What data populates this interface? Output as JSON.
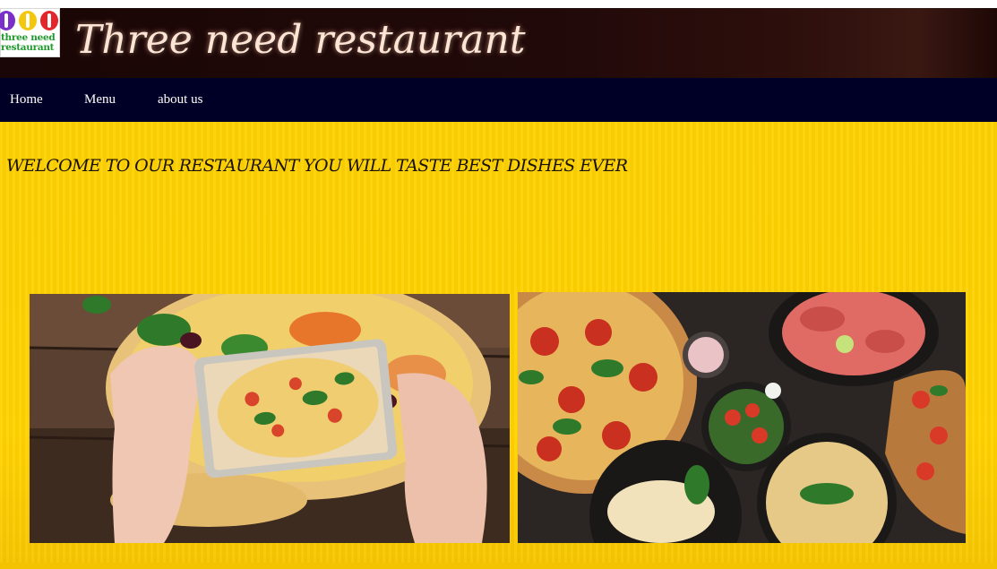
{
  "header": {
    "logo_text": "three need\nrestaurant",
    "title": "Three need restaurant"
  },
  "nav": {
    "items": [
      {
        "label": "Home"
      },
      {
        "label": "Menu"
      },
      {
        "label": "about us"
      }
    ]
  },
  "main": {
    "welcome": "WELCOME TO OUR RESTAURANT YOU WILL TASTE BEST DISHES EVER",
    "images": [
      {
        "name": "hands-photographing-pizza-photo"
      },
      {
        "name": "pizza-and-dishes-table-photo"
      }
    ]
  },
  "colors": {
    "header_bg": "#1a0606",
    "nav_bg": "#000027",
    "main_bg": "#fdd100",
    "title_text": "#fde5d6"
  }
}
